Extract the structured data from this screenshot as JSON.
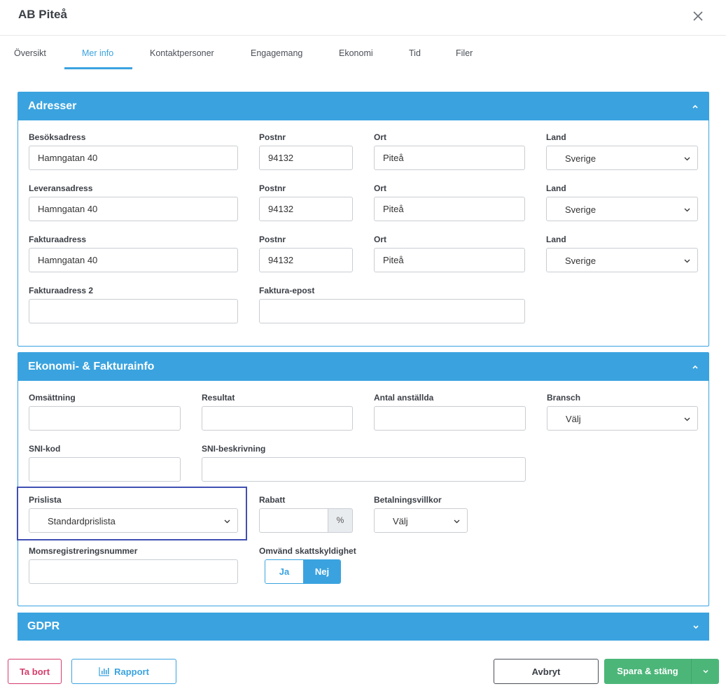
{
  "header": {
    "title": "AB Piteå"
  },
  "tabs": [
    "Översikt",
    "Mer info",
    "Kontaktpersoner",
    "Engagemang",
    "Ekonomi",
    "Tid",
    "Filer"
  ],
  "adresser": {
    "title": "Adresser",
    "rows": [
      {
        "label": "Besöksadress",
        "address": "Hamngatan 40",
        "postnr_label": "Postnr",
        "postnr": "94132",
        "ort_label": "Ort",
        "ort": "Piteå",
        "land_label": "Land",
        "land": "Sverige"
      },
      {
        "label": "Leveransadress",
        "address": "Hamngatan 40",
        "postnr_label": "Postnr",
        "postnr": "94132",
        "ort_label": "Ort",
        "ort": "Piteå",
        "land_label": "Land",
        "land": "Sverige"
      },
      {
        "label": "Fakturaadress",
        "address": "Hamngatan 40",
        "postnr_label": "Postnr",
        "postnr": "94132",
        "ort_label": "Ort",
        "ort": "Piteå",
        "land_label": "Land",
        "land": "Sverige"
      }
    ],
    "faktura2_label": "Fakturaadress 2",
    "faktura2": "",
    "epost_label": "Faktura-epost",
    "epost": ""
  },
  "ekonomi": {
    "title": "Ekonomi- & Fakturainfo",
    "omsattning_label": "Omsättning",
    "resultat_label": "Resultat",
    "anstallda_label": "Antal anställda",
    "bransch_label": "Bransch",
    "bransch": "Välj",
    "sni_label": "SNI-kod",
    "sni_desc_label": "SNI-beskrivning",
    "prislista_label": "Prislista",
    "prislista": "Standardprislista",
    "rabatt_label": "Rabatt",
    "rabatt_unit": "%",
    "villkor_label": "Betalningsvillkor",
    "villkor": "Välj",
    "moms_label": "Momsregistreringsnummer",
    "omvand_label": "Omvänd skattskyldighet",
    "ja": "Ja",
    "nej": "Nej"
  },
  "gdpr": {
    "title": "GDPR"
  },
  "footer": {
    "delete": "Ta bort",
    "report": "Rapport",
    "cancel": "Avbryt",
    "save": "Spara & stäng"
  },
  "colors": {
    "accent": "#3aa3df",
    "danger": "#d63c6b",
    "success": "#4cb679",
    "focus": "#3f4fb3"
  },
  "icons": [
    "close-icon",
    "chevron-up-icon",
    "chevron-down-icon",
    "bar-chart-icon"
  ]
}
